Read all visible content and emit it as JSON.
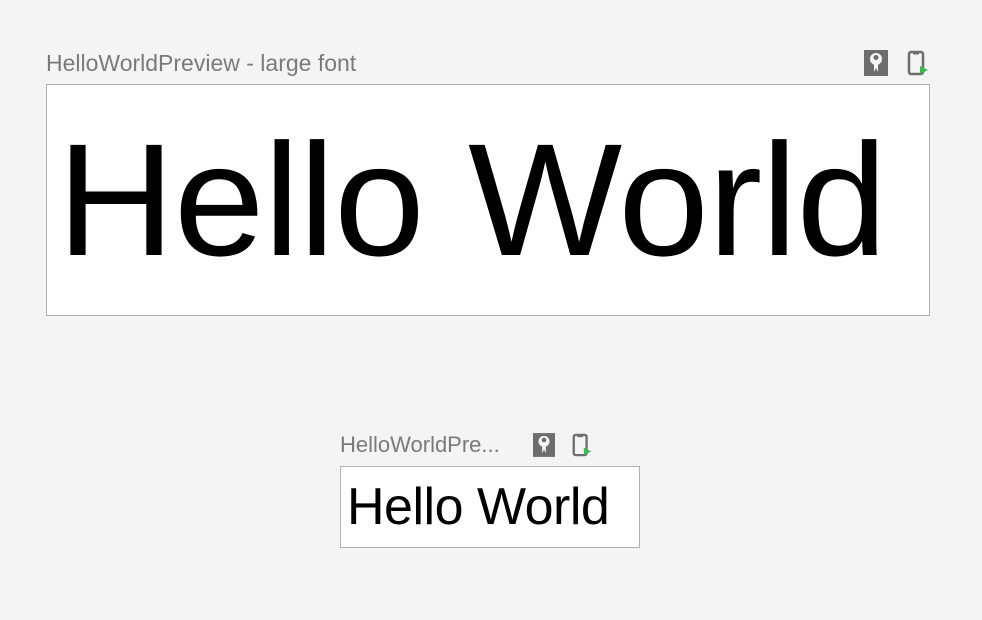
{
  "previews": {
    "large": {
      "title": "HelloWorldPreview - large font",
      "content": "Hello World"
    },
    "small": {
      "title": "HelloWorldPre...",
      "content": "Hello World"
    }
  }
}
